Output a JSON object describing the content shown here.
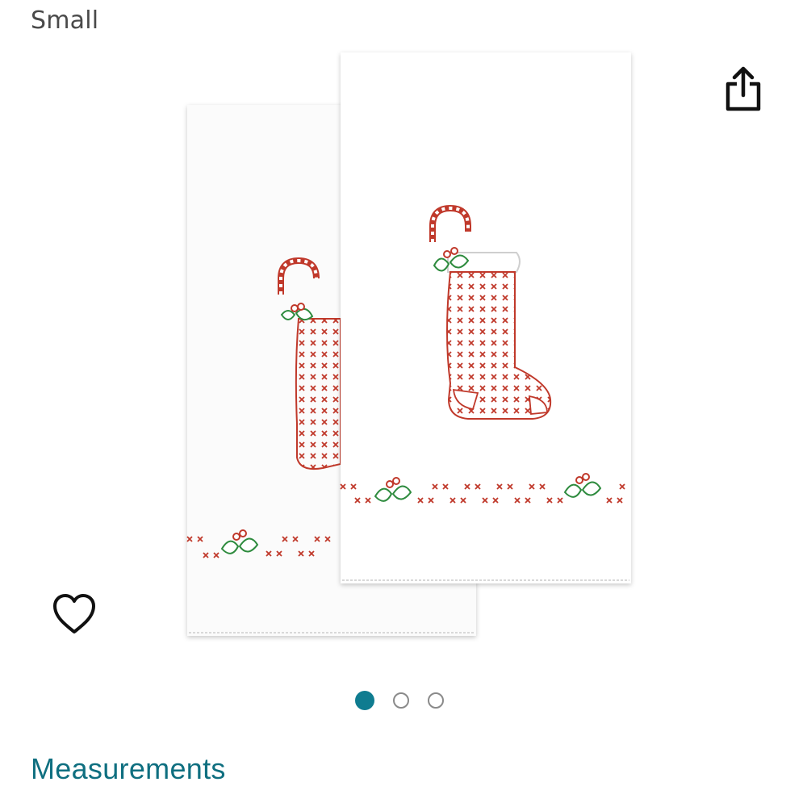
{
  "header": {
    "size_label": "Small"
  },
  "actions": {
    "share_icon": "share-icon",
    "wishlist_icon": "heart-outline-icon"
  },
  "gallery": {
    "image_description_icon": "product-image",
    "total_images": 3,
    "active_index": 0
  },
  "sections": {
    "measurements_heading": "Measurements"
  },
  "colors": {
    "accent": "#0f7c90",
    "heading": "#0f6f80",
    "text": "#4a4a4a",
    "stitch_red": "#c0392b",
    "stitch_green": "#2e8b3e"
  }
}
